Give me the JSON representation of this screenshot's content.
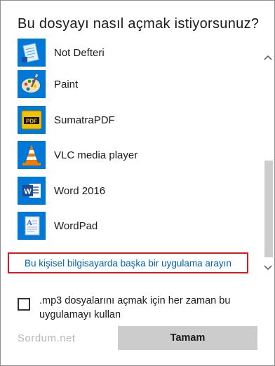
{
  "dialog": {
    "title": "Bu dosyayı nasıl açmak istiyorsunuz?"
  },
  "apps": [
    {
      "label": "Not Defteri",
      "icon": "notepad-icon"
    },
    {
      "label": "Paint",
      "icon": "paint-palette-icon"
    },
    {
      "label": "SumatraPDF",
      "icon": "sumatra-pdf-icon"
    },
    {
      "label": "VLC media player",
      "icon": "vlc-cone-icon"
    },
    {
      "label": "Word 2016",
      "icon": "word-icon"
    },
    {
      "label": "WordPad",
      "icon": "wordpad-icon"
    }
  ],
  "search_link": "Bu kişisel bilgisayarda başka bir uygulama arayın",
  "always_use": {
    "label": ".mp3 dosyalarını açmak için her zaman bu uygulamayı kullan",
    "checked": false
  },
  "watermark": "Sordum.net",
  "ok_button": "Tamam",
  "colors": {
    "accent_tile": "#0078d7",
    "link": "#0063b1",
    "highlight_border": "#e0141e",
    "button_bg": "#cccccc"
  }
}
